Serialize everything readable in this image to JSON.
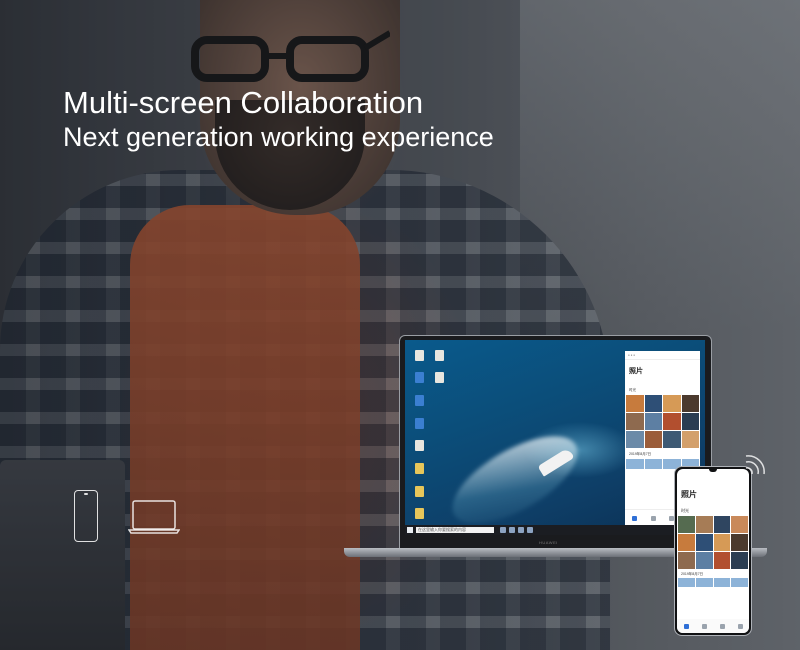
{
  "headline": "Multi-screen Collaboration",
  "subheadline": "Next generation working experience",
  "laptop": {
    "brand": "HUAWEI",
    "taskbar_search": "在这里输入你要搜索的内容",
    "mirror_window": {
      "title": "照片",
      "section": "时光",
      "date_label": "2019年8月7日"
    }
  },
  "phone": {
    "title": "照片",
    "section": "时光",
    "date_label": "2019年8月7日"
  },
  "icons": {
    "phone_outline": "phone-outline-icon",
    "laptop_outline": "laptop-outline-icon",
    "wireless_signal": "wireless-signal-icon"
  }
}
